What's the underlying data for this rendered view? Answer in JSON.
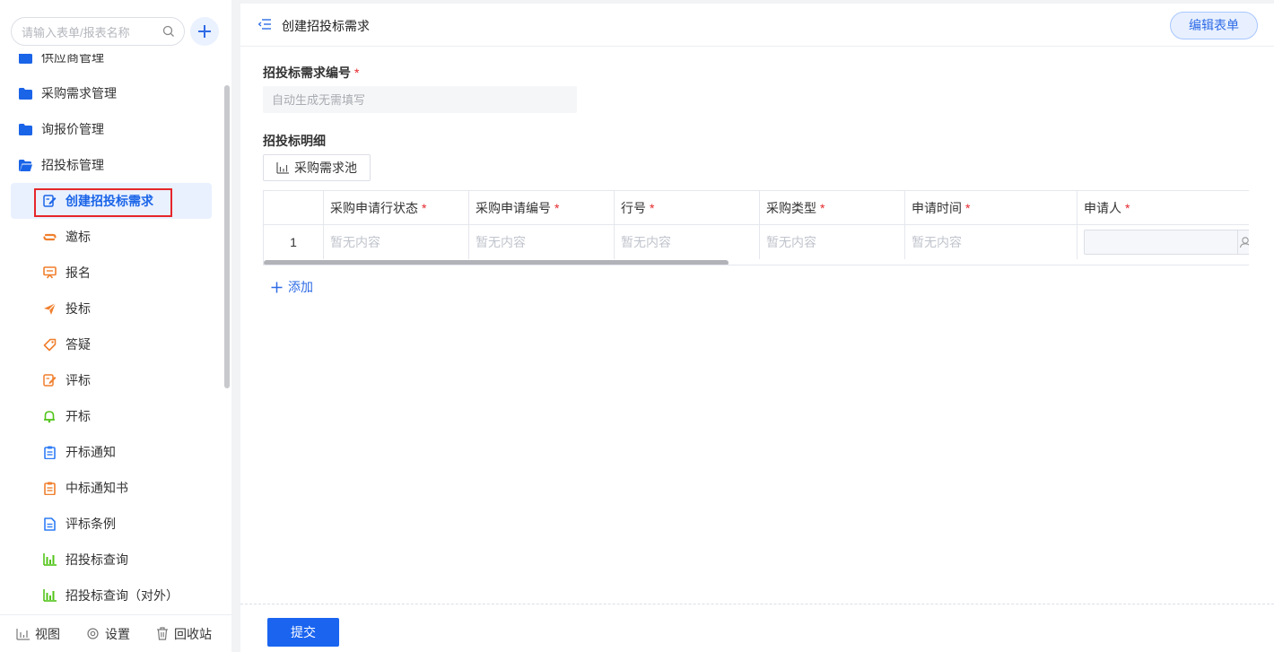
{
  "sidebar": {
    "search": {
      "placeholder": "请输入表单/报表名称",
      "value": ""
    },
    "groups": [
      {
        "label": "供应商管理",
        "color": "#1a64e8"
      },
      {
        "label": "采购需求管理",
        "color": "#1a64e8"
      },
      {
        "label": "询报价管理",
        "color": "#1a64e8"
      },
      {
        "label": "招投标管理",
        "color": "#1a64e8"
      }
    ],
    "items": [
      {
        "label": "创建招投标需求",
        "icon": "form-edit-icon",
        "color": "#1a64e8",
        "active": true
      },
      {
        "label": "邀标",
        "icon": "link-icon",
        "color": "#f07f2d"
      },
      {
        "label": "报名",
        "icon": "presentation-icon",
        "color": "#f07f2d"
      },
      {
        "label": "投标",
        "icon": "paper-plane-icon",
        "color": "#f07f2d"
      },
      {
        "label": "答疑",
        "icon": "tag-icon",
        "color": "#f07f2d"
      },
      {
        "label": "评标",
        "icon": "form-edit-icon",
        "color": "#f07f2d"
      },
      {
        "label": "开标",
        "icon": "bell-icon",
        "color": "#52c41a"
      },
      {
        "label": "开标通知",
        "icon": "clipboard-icon",
        "color": "#2f7cf6"
      },
      {
        "label": "中标通知书",
        "icon": "clipboard-icon",
        "color": "#f07f2d"
      },
      {
        "label": "评标条例",
        "icon": "document-icon",
        "color": "#2f7cf6"
      },
      {
        "label": "招投标查询",
        "icon": "bar-chart-icon",
        "color": "#52c41a"
      },
      {
        "label": "招投标查询（对外）",
        "icon": "bar-chart-icon",
        "color": "#52c41a"
      }
    ],
    "footer": {
      "view": "视图",
      "settings": "设置",
      "recycle": "回收站"
    }
  },
  "header": {
    "title": "创建招投标需求",
    "edit_form": "编辑表单"
  },
  "form": {
    "code_label": "招投标需求编号",
    "required_mark": "*",
    "code_placeholder": "自动生成无需填写",
    "detail_label": "招投标明细",
    "pool_button": "采购需求池",
    "table": {
      "columns": [
        "采购申请行状态",
        "采购申请编号",
        "行号",
        "采购类型",
        "申请时间",
        "申请人"
      ],
      "rows": [
        {
          "index": "1",
          "cells": [
            "暂无内容",
            "暂无内容",
            "暂无内容",
            "暂无内容",
            "暂无内容"
          ]
        }
      ]
    },
    "add_row": "添加",
    "submit": "提交"
  }
}
